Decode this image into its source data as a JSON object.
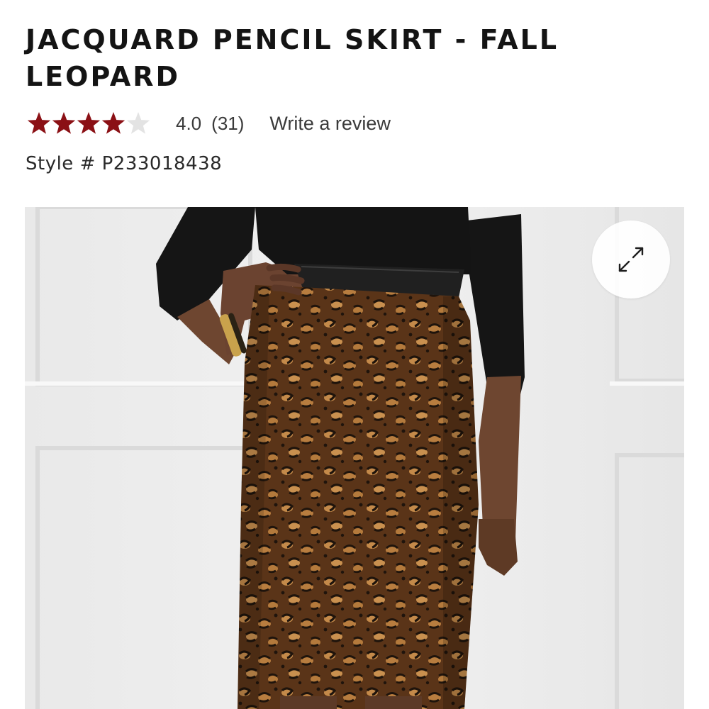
{
  "product": {
    "title": "JACQUARD PENCIL SKIRT - FALL LEOPARD",
    "rating": {
      "value_text": "4.0",
      "value": 4.0,
      "max_stars": 5,
      "count_text": "(31)",
      "filled_color": "#8b1015",
      "empty_color": "#e3e3e3"
    },
    "write_review_label": "Write a review",
    "style_text": "Style # P233018438"
  },
  "image": {
    "expand_icon": "expand-diagonal-arrows-icon"
  }
}
